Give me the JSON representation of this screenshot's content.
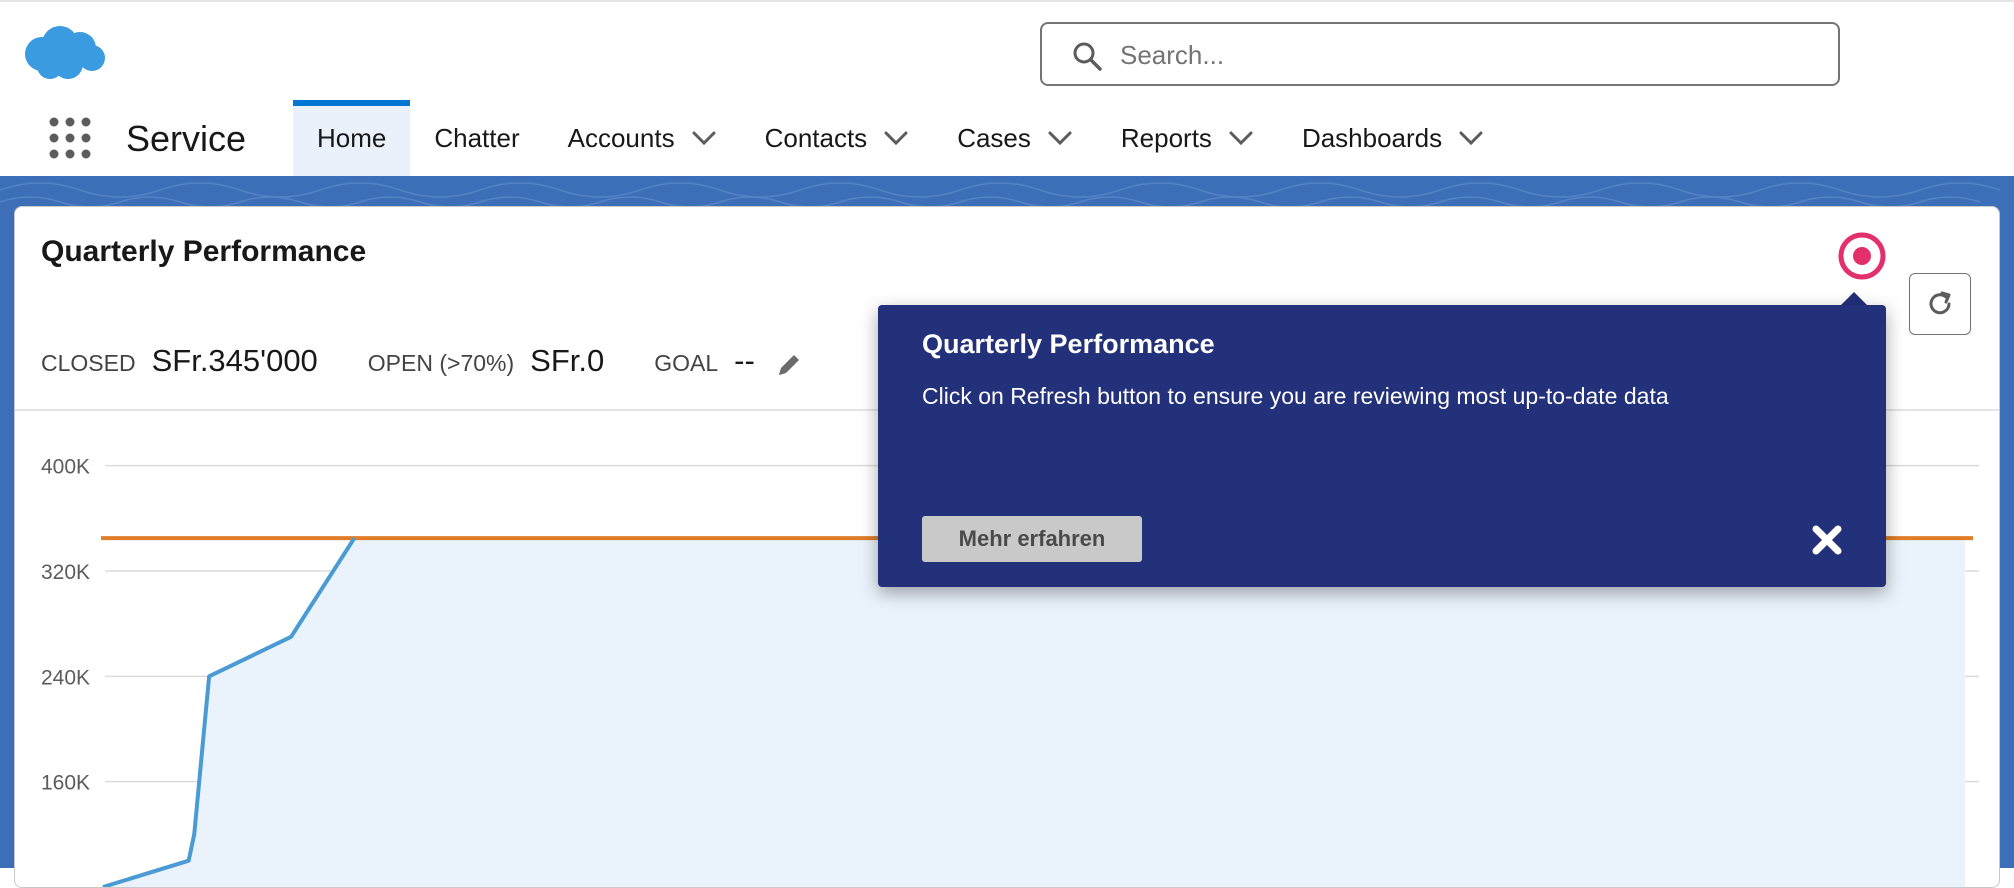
{
  "header": {
    "search": {
      "placeholder": "Search..."
    }
  },
  "nav": {
    "app_name": "Service",
    "tabs": [
      {
        "label": "Home",
        "active": true,
        "has_menu": false
      },
      {
        "label": "Chatter",
        "active": false,
        "has_menu": false
      },
      {
        "label": "Accounts",
        "active": false,
        "has_menu": true
      },
      {
        "label": "Contacts",
        "active": false,
        "has_menu": true
      },
      {
        "label": "Cases",
        "active": false,
        "has_menu": true
      },
      {
        "label": "Reports",
        "active": false,
        "has_menu": true
      },
      {
        "label": "Dashboards",
        "active": false,
        "has_menu": true
      }
    ]
  },
  "card": {
    "title": "Quarterly Performance",
    "metrics": {
      "closed_label": "CLOSED",
      "closed_value": "SFr.345'000",
      "open_label": "OPEN (>70%)",
      "open_value": "SFr.0",
      "goal_label": "GOAL",
      "goal_value": "--"
    }
  },
  "tooltip": {
    "title": "Quarterly Performance",
    "body": "Click on Refresh button to ensure you are reviewing most up-to-date data",
    "button_label": "Mehr erfahren"
  },
  "colors": {
    "brand_blue": "#0176d3",
    "tooltip_bg": "#23307a",
    "closed_line": "#4a9ad4",
    "goal_line": "#e07d28",
    "record_icon": "#e3306c"
  },
  "chart_data": {
    "type": "line",
    "y_ticks": [
      "400K",
      "320K",
      "240K",
      "160K"
    ],
    "ylim": [
      80000,
      440000
    ],
    "series": [
      {
        "values": [
          {
            "x": 0.0,
            "y": 80000
          },
          {
            "x": 0.046,
            "y": 100000
          },
          {
            "x": 0.049,
            "y": 120000
          },
          {
            "x": 0.057,
            "y": 240000
          },
          {
            "x": 0.101,
            "y": 270000
          },
          {
            "x": 0.135,
            "y": 345000
          },
          {
            "x": 1.0,
            "y": 345000
          }
        ]
      },
      {
        "values": [
          {
            "x": 0.0,
            "y": 345000
          },
          {
            "x": 1.0,
            "y": 345000
          }
        ]
      }
    ]
  }
}
